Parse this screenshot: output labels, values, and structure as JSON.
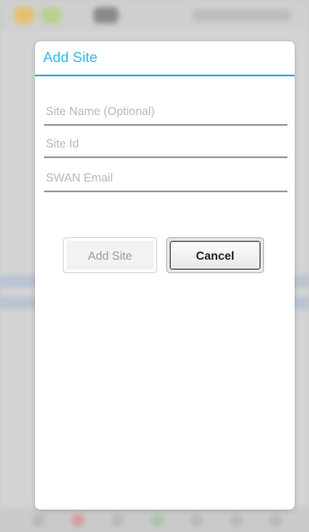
{
  "dialog": {
    "title": "Add Site",
    "fields": [
      {
        "placeholder": "Site Name (Optional)",
        "value": ""
      },
      {
        "placeholder": "Site Id",
        "value": ""
      },
      {
        "placeholder": "SWAN Email",
        "value": ""
      }
    ],
    "buttons": {
      "add_label": "Add Site",
      "cancel_label": "Cancel"
    },
    "accent_color": "#33b5e5"
  }
}
